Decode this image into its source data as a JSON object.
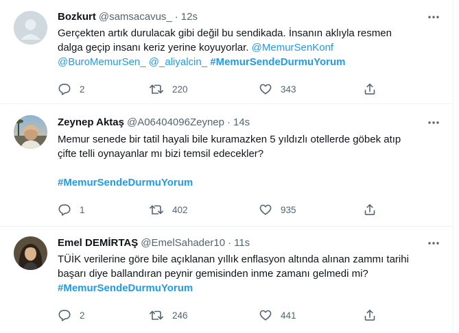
{
  "tweets": [
    {
      "name": "Bozkurt",
      "handle": "@samsacavus_",
      "dot": "·",
      "time": "12s",
      "lines": [
        [
          {
            "t": "Gerçekten artık durulacak gibi değil bu sendikada. İnsanın aklıyla resmen",
            "k": "text"
          }
        ],
        [
          {
            "t": "dalga geçip insanı keriz yerine koyuyorlar. ",
            "k": "text"
          },
          {
            "t": "@MemurSenKonf",
            "k": "link"
          }
        ],
        [
          {
            "t": "@BuroMemurSen_",
            "k": "link"
          },
          {
            "t": " ",
            "k": "text"
          },
          {
            "t": "@_aliyalcin_",
            "k": "link"
          },
          {
            "t": " ",
            "k": "text"
          },
          {
            "t": "#MemurSendeDurmuYorum",
            "k": "hashtag"
          }
        ]
      ],
      "replies": "2",
      "retweets": "220",
      "likes": "343"
    },
    {
      "name": "Zeynep Aktaş",
      "handle": "@A06404096Zeynep",
      "dot": "·",
      "time": "14s",
      "lines": [
        [
          {
            "t": "Memur senede bir tatil hayali bile kuramazken 5 yıldızlı otellerde göbek atıp",
            "k": "text"
          }
        ],
        [
          {
            "t": "çifte telli oynayanlar  mı bizi temsil edecekler?",
            "k": "text"
          }
        ],
        [
          {
            "t": "",
            "k": "text"
          }
        ],
        [
          {
            "t": "#MemurSendeDurmuYorum",
            "k": "hashtag"
          }
        ]
      ],
      "replies": "1",
      "retweets": "402",
      "likes": "935"
    },
    {
      "name": "Emel DEMİRTAŞ",
      "handle": "@EmelSahader10",
      "dot": "·",
      "time": "11s",
      "lines": [
        [
          {
            "t": "TÜİK verilerine göre bile açıklanan yıllık enflasyon altında alınan zammı tarihi",
            "k": "text"
          }
        ],
        [
          {
            "t": "başarı diye ballandıran peynir gemisinden inme zamanı gelmedi mi?",
            "k": "text"
          }
        ],
        [
          {
            "t": "#MemurSendeDurmuYorum",
            "k": "hashtag"
          }
        ]
      ],
      "replies": "2",
      "retweets": "246",
      "likes": "441"
    }
  ]
}
